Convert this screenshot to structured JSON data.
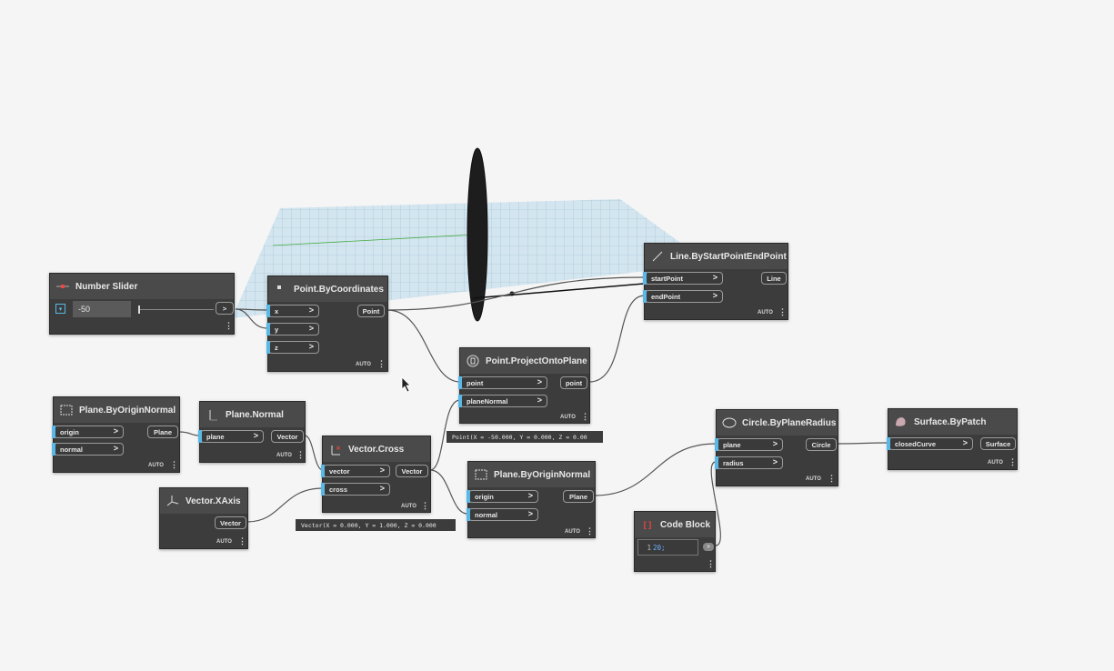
{
  "nodes": {
    "number_slider": {
      "title": "Number Slider",
      "value": "-50"
    },
    "point_by_coordinates": {
      "title": "Point.ByCoordinates",
      "inputs": [
        "x",
        "y",
        "z"
      ],
      "output": "Point",
      "lacing": "AUTO"
    },
    "line": {
      "title": "Line.ByStartPointEndPoint",
      "inputs": [
        "startPoint",
        "endPoint"
      ],
      "output": "Line",
      "lacing": "AUTO"
    },
    "project": {
      "title": "Point.ProjectOntoPlane",
      "inputs": [
        "point",
        "planeNormal"
      ],
      "output": "point",
      "lacing": "AUTO",
      "preview": "Point(X = -50.000, Y = 0.000, Z = 0.00"
    },
    "plane1": {
      "title": "Plane.ByOriginNormal",
      "inputs": [
        "origin",
        "normal"
      ],
      "output": "Plane",
      "lacing": "AUTO"
    },
    "plane_normal": {
      "title": "Plane.Normal",
      "inputs": [
        "plane"
      ],
      "output": "Vector",
      "lacing": "AUTO"
    },
    "vector_cross": {
      "title": "Vector.Cross",
      "inputs": [
        "vector",
        "cross"
      ],
      "output": "Vector",
      "lacing": "AUTO",
      "preview": "Vector(X = 0.000, Y = 1.000, Z = 0.000"
    },
    "vector_xaxis": {
      "title": "Vector.XAxis",
      "output": "Vector",
      "lacing": "AUTO"
    },
    "plane2": {
      "title": "Plane.ByOriginNormal",
      "inputs": [
        "origin",
        "normal"
      ],
      "output": "Plane",
      "lacing": "AUTO"
    },
    "circle": {
      "title": "Circle.ByPlaneRadius",
      "inputs": [
        "plane",
        "radius"
      ],
      "output": "Circle",
      "lacing": "AUTO"
    },
    "surface": {
      "title": "Surface.ByPatch",
      "inputs": [
        "closedCurve"
      ],
      "output": "Surface",
      "lacing": "AUTO"
    },
    "code_block": {
      "title": "Code Block",
      "line_no": "1",
      "code": "20;"
    }
  },
  "colors": {
    "port_accent": "#5ab8e6",
    "node_body": "#3c3c3c",
    "node_header": "#4a4a4a",
    "grid": "#9fc3d6"
  }
}
